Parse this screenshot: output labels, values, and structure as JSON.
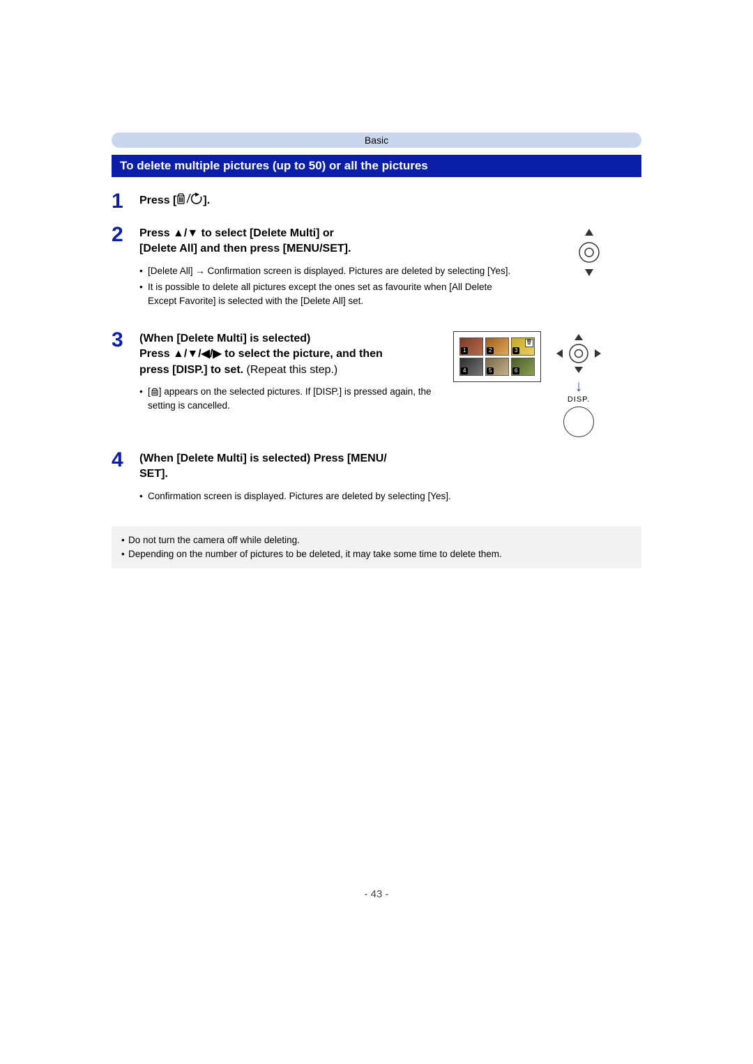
{
  "section_tab": "Basic",
  "section_title": "To delete multiple pictures (up to 50) or all the pictures",
  "steps": {
    "s1": {
      "num": "1",
      "title_prefix": "Press [",
      "title_suffix": "]."
    },
    "s2": {
      "num": "2",
      "title_line1_a": "Press ",
      "title_line1_b": " to select [Delete Multi] or",
      "title_line2": "[Delete All] and then press [MENU/SET].",
      "bullets": [
        "[Delete All] → Confirmation screen is displayed. Pictures are deleted by selecting [Yes].",
        "It is possible to delete all pictures except the ones set as favourite when [All Delete Except Favorite] is selected with the [Delete All] set."
      ]
    },
    "s3": {
      "num": "3",
      "title_line1": "(When [Delete Multi] is selected)",
      "title_line2_a": "Press ",
      "title_line2_b": " to select the picture, and then",
      "title_line3_bold": "press [DISP.] to set. ",
      "title_line3_norm": "(Repeat this step.)",
      "bullets_a": "[",
      "bullets_b": "] appears on the selected pictures. If [DISP.] is pressed again, the setting is cancelled.",
      "thumbs": [
        "1",
        "2",
        "3",
        "4",
        "5",
        "6"
      ],
      "disp_label": "DISP."
    },
    "s4": {
      "num": "4",
      "title_line1": "(When [Delete Multi] is selected) Press [MENU/",
      "title_line2": "SET].",
      "bullets": [
        "Confirmation screen is displayed. Pictures are deleted by selecting [Yes]."
      ]
    }
  },
  "glyphs": {
    "updown": "▲/▼",
    "fourway": "▲/▼/◀/▶"
  },
  "notes": [
    "Do not turn the camera off while deleting.",
    "Depending on the number of pictures to be deleted, it may take some time to delete them."
  ],
  "page_number": "- 43 -"
}
